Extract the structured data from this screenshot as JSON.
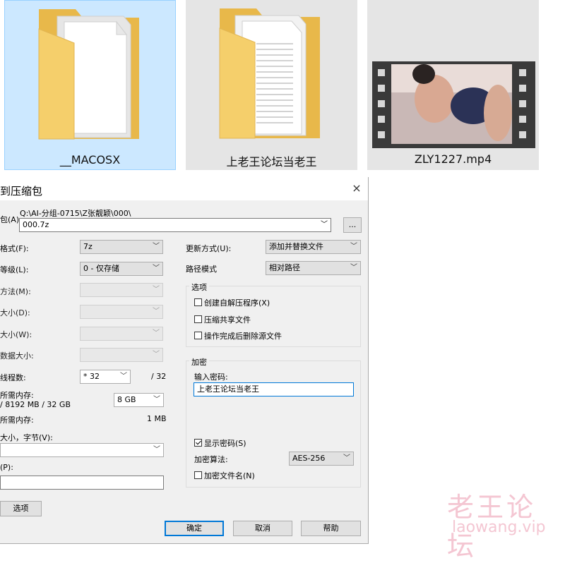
{
  "files": [
    {
      "name": "__MACOSX",
      "icon": "folder-icon",
      "selected": true
    },
    {
      "name": "上老王论坛当老王",
      "icon": "folder-with-documents-icon",
      "selected": false
    },
    {
      "name": "ZLY1227.mp4",
      "icon": "video-thumbnail",
      "selected": false
    }
  ],
  "dialog": {
    "title": "到压缩包",
    "close": "×",
    "archive_label": "包(A)",
    "archive_path": "Q:\\AI-分组-0715\\Z张靓颖\\000\\",
    "archive_name": "000.7z",
    "browse": "...",
    "format_label": "格式(F):",
    "format_value": "7z",
    "level_label": "等级(L):",
    "level_value": "0 - 仅存储",
    "method_label": "方法(M):",
    "dict_label": "大小(D):",
    "word_label": "大小(W):",
    "solid_label": "数据大小:",
    "threads_label": "线程数:",
    "threads_value": "* 32",
    "threads_total": "/ 32",
    "mem_comp_label": "所需内存:",
    "mem_comp_value": "/ 8192 MB / 32 GB",
    "mem_limit_value": "8 GB",
    "mem_decomp_label": "所需内存:",
    "mem_decomp_value": "1 MB",
    "split_label": "大小，字节(V):",
    "params_label": "(P):",
    "options_button": "选项",
    "update_label": "更新方式(U):",
    "update_value": "添加并替换文件",
    "path_label": "路径模式",
    "path_value": "相对路径",
    "options_group": "选项",
    "opt_sfx": "创建自解压程序(X)",
    "opt_shared": "压缩共享文件",
    "opt_delete": "操作完成后删除源文件",
    "enc_group": "加密",
    "password_label": "输入密码:",
    "password_value": "上老王论坛当老王",
    "show_password": "显示密码(S)",
    "enc_method_label": "加密算法:",
    "enc_method_value": "AES-256",
    "encrypt_names": "加密文件名(N)",
    "ok": "确定",
    "cancel": "取消",
    "help": "帮助",
    "dropdown_arrow": "﹀"
  },
  "watermark": {
    "line1": "老王论坛",
    "line2": "laowang.vip"
  },
  "colors": {
    "selection_bg": "#cce8ff",
    "dialog_bg": "#f0f0f0",
    "accent": "#0078d7",
    "watermark": "#f4c6d2",
    "folder": "#f5cf6b"
  }
}
